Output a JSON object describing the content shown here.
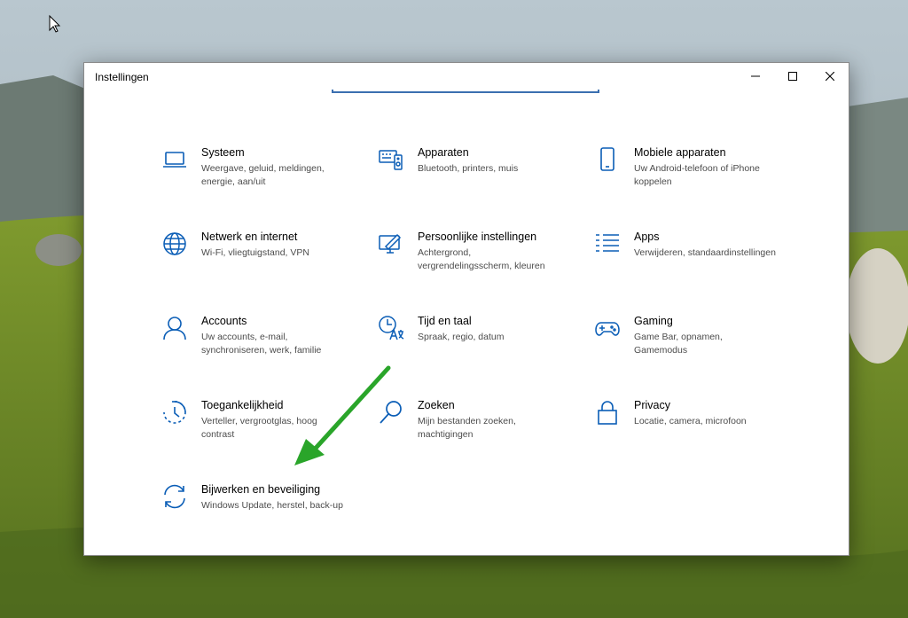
{
  "window": {
    "title": "Instellingen"
  },
  "colors": {
    "accent": "#0a5db6",
    "arrow": "#2aa52a"
  },
  "tiles": [
    {
      "title": "Systeem",
      "desc": "Weergave, geluid, meldingen, energie, aan/uit",
      "icon": "laptop-icon"
    },
    {
      "title": "Apparaten",
      "desc": "Bluetooth, printers, muis",
      "icon": "devices-icon"
    },
    {
      "title": "Mobiele apparaten",
      "desc": "Uw Android-telefoon of iPhone koppelen",
      "icon": "phone-icon"
    },
    {
      "title": "Netwerk en internet",
      "desc": "Wi-Fi, vliegtuigstand, VPN",
      "icon": "globe-icon"
    },
    {
      "title": "Persoonlijke instellingen",
      "desc": "Achtergrond, vergrendelingsscherm, kleuren",
      "icon": "personalize-icon"
    },
    {
      "title": "Apps",
      "desc": "Verwijderen, standaardinstellingen",
      "icon": "apps-list-icon"
    },
    {
      "title": "Accounts",
      "desc": "Uw accounts, e-mail, synchroniseren, werk, familie",
      "icon": "person-icon"
    },
    {
      "title": "Tijd en taal",
      "desc": "Spraak, regio, datum",
      "icon": "time-language-icon"
    },
    {
      "title": "Gaming",
      "desc": "Game Bar, opnamen, Gamemodus",
      "icon": "gamepad-icon"
    },
    {
      "title": "Toegankelijkheid",
      "desc": "Verteller, vergrootglas, hoog contrast",
      "icon": "accessibility-icon"
    },
    {
      "title": "Zoeken",
      "desc": "Mijn bestanden zoeken, machtigingen",
      "icon": "search-icon"
    },
    {
      "title": "Privacy",
      "desc": "Locatie, camera, microfoon",
      "icon": "lock-icon"
    },
    {
      "title": "Bijwerken en beveiliging",
      "desc": "Windows Update, herstel, back-up",
      "icon": "update-icon"
    }
  ]
}
